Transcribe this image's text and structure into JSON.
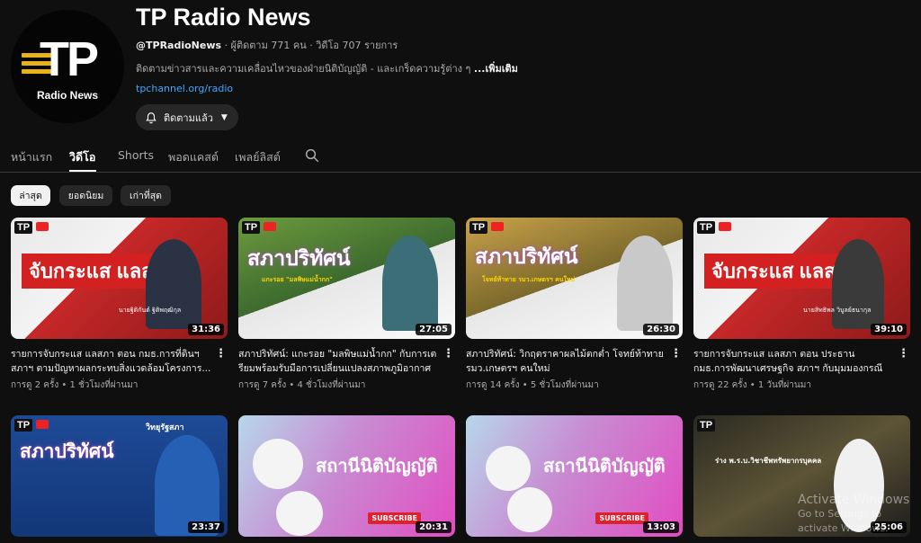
{
  "channel": {
    "name": "TP Radio News",
    "handle": "@TPRadioNews",
    "stats": " · ผู้ติดตาม 771 คน · วิดีโอ 707 รายการ",
    "description": "ติดตามข่าวสารและความเคลื่อนไหวของฝ่ายนิติบัญญัติ - และเกร็ดความรู้ต่าง ๆ",
    "more_label": "...เพิ่มเติม",
    "link": "tpchannel.org/radio",
    "logo_text": "TP",
    "logo_sub": "Radio News",
    "subscribe_label": "ติดตามแล้ว"
  },
  "tabs": [
    {
      "label": "หน้าแรก",
      "active": false
    },
    {
      "label": "วิดีโอ",
      "active": true
    },
    {
      "label": "Shorts",
      "active": false
    },
    {
      "label": "พอดแคสต์",
      "active": false
    },
    {
      "label": "เพลย์ลิสต์",
      "active": false
    }
  ],
  "chips": [
    {
      "label": "ล่าสุด",
      "active": true
    },
    {
      "label": "ยอดนิยม",
      "active": false
    },
    {
      "label": "เก่าที่สุด",
      "active": false
    }
  ],
  "videos": [
    {
      "title": "รายการจับกระแส แลสภา ตอน กมธ.การที่ดินฯ สภาฯ ตามปัญหาผลกระทบสิ่งแวดล้อมโครงการ...",
      "views": "การดู 2 ครั้ง",
      "age": "1 ชั่วโมงที่ผ่านมา",
      "duration": "31:36",
      "banner": "จับกระแส แลสภา",
      "caption": "นายฐิติกันต์ ฐิติพฤฒิกุล"
    },
    {
      "title": "สภาปริทัศน์: แกะรอย \"มลพิษแม่น้ำกก\" กับการเตรียมพร้อมรับมือการเปลี่ยนแปลงสภาพภูมิอากาศ",
      "views": "การดู 7 ครั้ง",
      "age": "4 ชั่วโมงที่ผ่านมา",
      "duration": "27:05",
      "banner": "สภาปริทัศน์",
      "caption": "แกะรอย \"มลพิษแม่น้ำกก\""
    },
    {
      "title": "สภาปริทัศน์: วิกฤตราคาผลไม้ตกต่ำ โจทย์ท้าทาย รมว.เกษตรฯ คนใหม่",
      "views": "การดู 14 ครั้ง",
      "age": "5 ชั่วโมงที่ผ่านมา",
      "duration": "26:30",
      "banner": "สภาปริทัศน์",
      "caption": "โจทย์ท้าทาย รมว.เกษตรฯ คนใหม่"
    },
    {
      "title": "รายการจับกระแส แลสภา ตอน ประธาน กมธ.การพัฒนาเศรษฐกิจ สภาฯ กับมุมมองกรณีภาษีทรัม...",
      "views": "การดู 22 ครั้ง",
      "age": "1 วันที่ผ่านมา",
      "duration": "39:10",
      "banner": "จับกระแส แลสภา",
      "caption": "นายสิทธิพล วิบูลย์ธนากุล"
    },
    {
      "title": "",
      "views": "",
      "age": "",
      "duration": "23:37",
      "banner": "สภาปริทัศน์",
      "caption": "วิทยุรัฐสภา"
    },
    {
      "title": "",
      "views": "",
      "age": "",
      "duration": "20:31",
      "banner": "สถานีนิติบัญญัติ",
      "caption": "SUBSCRIBE"
    },
    {
      "title": "",
      "views": "",
      "age": "",
      "duration": "13:03",
      "banner": "สถานีนิติบัญญัติ",
      "caption": "SUBSCRIBE"
    },
    {
      "title": "",
      "views": "",
      "age": "",
      "duration": "25:06",
      "banner": "ร่าง พ.ร.บ.วิชาชีพทรัพยากรบุคคล",
      "caption": ""
    }
  ],
  "watermark": {
    "line1": "Activate Windows",
    "line2": "Go to Settings to activate Windows."
  },
  "colors": {
    "background": "#0f0f0f",
    "chip": "#272727",
    "link": "#3ea6ff",
    "accent_red": "#e0202c"
  },
  "icons": {
    "bell": "bell-icon",
    "search": "search-icon",
    "menu": "kebab-menu-icon",
    "chevron": "chevron-down-icon"
  }
}
